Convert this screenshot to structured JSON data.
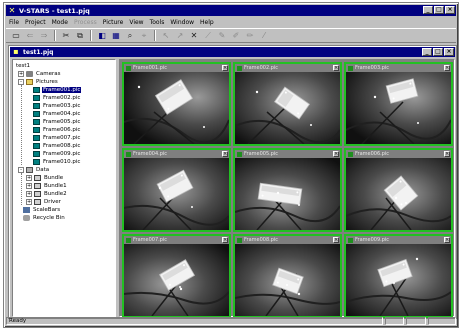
{
  "app": {
    "title": "V-STARS - test1.pjq",
    "window_buttons": [
      "_",
      "□",
      "×"
    ]
  },
  "menu": [
    {
      "label": "File",
      "enabled": true
    },
    {
      "label": "Project",
      "enabled": true
    },
    {
      "label": "Mode",
      "enabled": true
    },
    {
      "label": "Process",
      "enabled": false
    },
    {
      "label": "Picture",
      "enabled": true
    },
    {
      "label": "View",
      "enabled": true
    },
    {
      "label": "Tools",
      "enabled": true
    },
    {
      "label": "Window",
      "enabled": true
    },
    {
      "label": "Help",
      "enabled": true
    }
  ],
  "toolbar": {
    "icons": [
      "open-icon",
      "arrow-left-icon",
      "arrow-right-icon",
      "cut-icon",
      "copy-icon",
      "camera-icon",
      "picture-icon",
      "zoom-icon",
      "measure-icon",
      "select-icon",
      "pointer-icon",
      "cross-icon",
      "line-icon",
      "pen-icon",
      "edit-icon",
      "brush-icon",
      "draw-icon"
    ],
    "glyphs": [
      "▭",
      "⇐",
      "⇒",
      "✂",
      "⧉",
      "◧",
      "▦",
      "⌕",
      "⌖",
      "↖",
      "↗",
      "✕",
      "⟋",
      "✎",
      "✐",
      "✏",
      "⁄"
    ]
  },
  "document": {
    "title": "test1.pjq",
    "window_buttons": [
      "_",
      "□",
      "×"
    ]
  },
  "tree": {
    "root": "test1",
    "cameras": "Cameras",
    "pictures": "Pictures",
    "frames": [
      "Frame001.pic",
      "Frame002.pic",
      "Frame003.pic",
      "Frame004.pic",
      "Frame005.pic",
      "Frame006.pic",
      "Frame007.pic",
      "Frame008.pic",
      "Frame009.pic",
      "Frame010.pic"
    ],
    "selected_index": 0,
    "data": "Data",
    "bundles": [
      "Bundle",
      "Bundle1",
      "Bundle2",
      "Driver"
    ],
    "scalebars": "ScaleBars",
    "recycle": "Recycle Bin"
  },
  "frame_windows": [
    "Frame001.pic",
    "Frame002.pic",
    "Frame003.pic",
    "Frame004.pic",
    "Frame005.pic",
    "Frame006.pic",
    "Frame007.pic",
    "Frame008.pic",
    "Frame009.pic"
  ],
  "status": {
    "text": "Ready"
  },
  "colors": {
    "titlebar": "#000080",
    "frame_border": "#22c022",
    "window_bg": "#c0c0c0"
  }
}
